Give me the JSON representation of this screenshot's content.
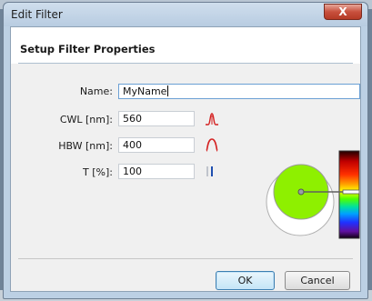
{
  "window": {
    "title": "Edit Filter",
    "close_glyph": "X"
  },
  "header": {
    "title": "Setup Filter Properties"
  },
  "form": {
    "name": {
      "label": "Name:",
      "value": "MyName"
    },
    "cwl": {
      "label": "CWL [nm]:",
      "value": "560",
      "icon": "gaussian-peak-icon"
    },
    "hbw": {
      "label": "HBW [nm]:",
      "value": "400",
      "icon": "wide-peak-icon"
    },
    "t": {
      "label": "T [%]:",
      "value": "100",
      "icon": "transmission-bar-icon"
    }
  },
  "preview": {
    "filter_color": "#8ef000",
    "icon": "color-spectrum-preview"
  },
  "buttons": {
    "ok": "OK",
    "cancel": "Cancel"
  },
  "colors": {
    "accent_red": "#d42020",
    "focus_border": "#6a9fd4"
  }
}
